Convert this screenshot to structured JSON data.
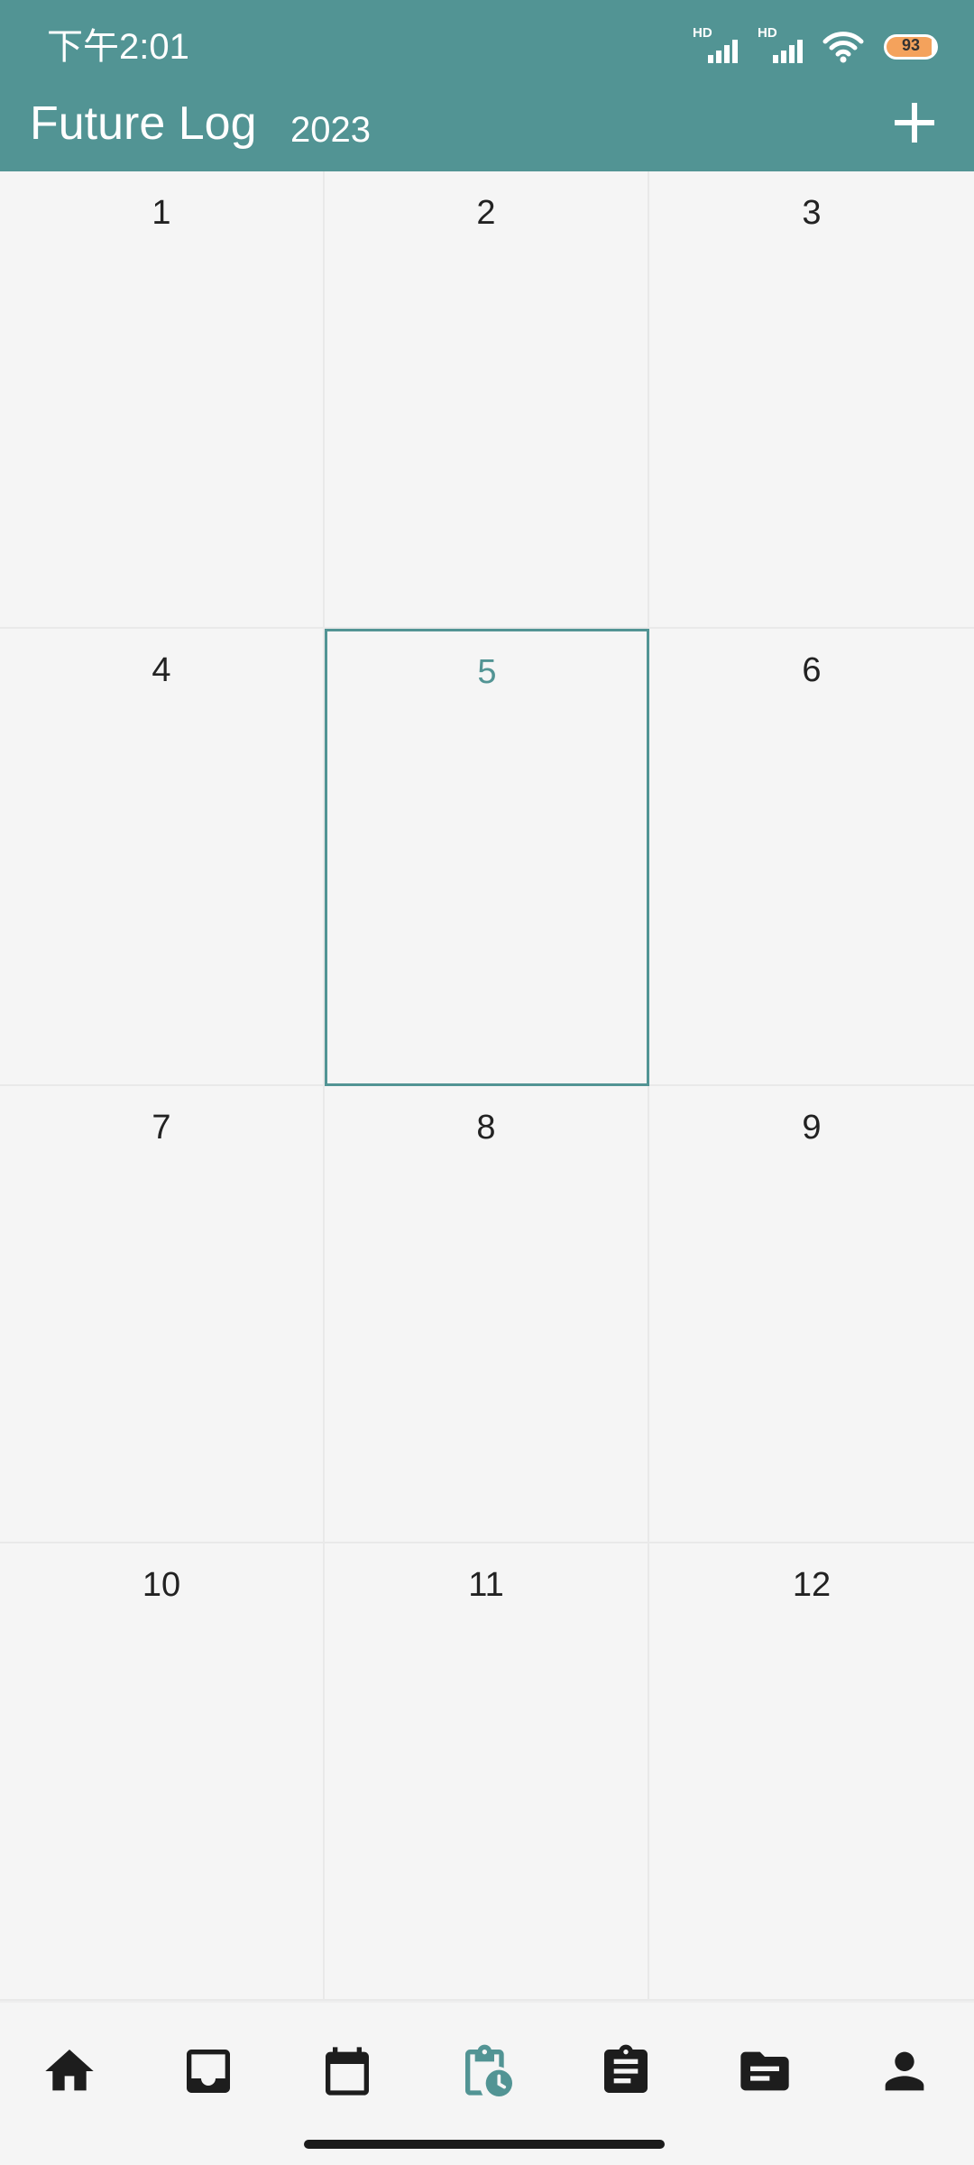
{
  "status_bar": {
    "time": "下午2:01",
    "signal_tag": "HD",
    "battery": "93"
  },
  "header": {
    "title": "Future Log",
    "year": "2023"
  },
  "months": [
    {
      "label": "1"
    },
    {
      "label": "2"
    },
    {
      "label": "3"
    },
    {
      "label": "4"
    },
    {
      "label": "5",
      "selected": true
    },
    {
      "label": "6"
    },
    {
      "label": "7"
    },
    {
      "label": "8"
    },
    {
      "label": "9"
    },
    {
      "label": "10"
    },
    {
      "label": "11"
    },
    {
      "label": "12"
    }
  ],
  "nav": [
    "home-icon",
    "inbox-icon",
    "calendar-icon",
    "clipboard-clock-icon",
    "assignment-icon",
    "folder-icon",
    "person-icon"
  ],
  "colors": {
    "accent": "#529494",
    "background": "#f5f5f5",
    "icon": "#1d1d1d"
  }
}
